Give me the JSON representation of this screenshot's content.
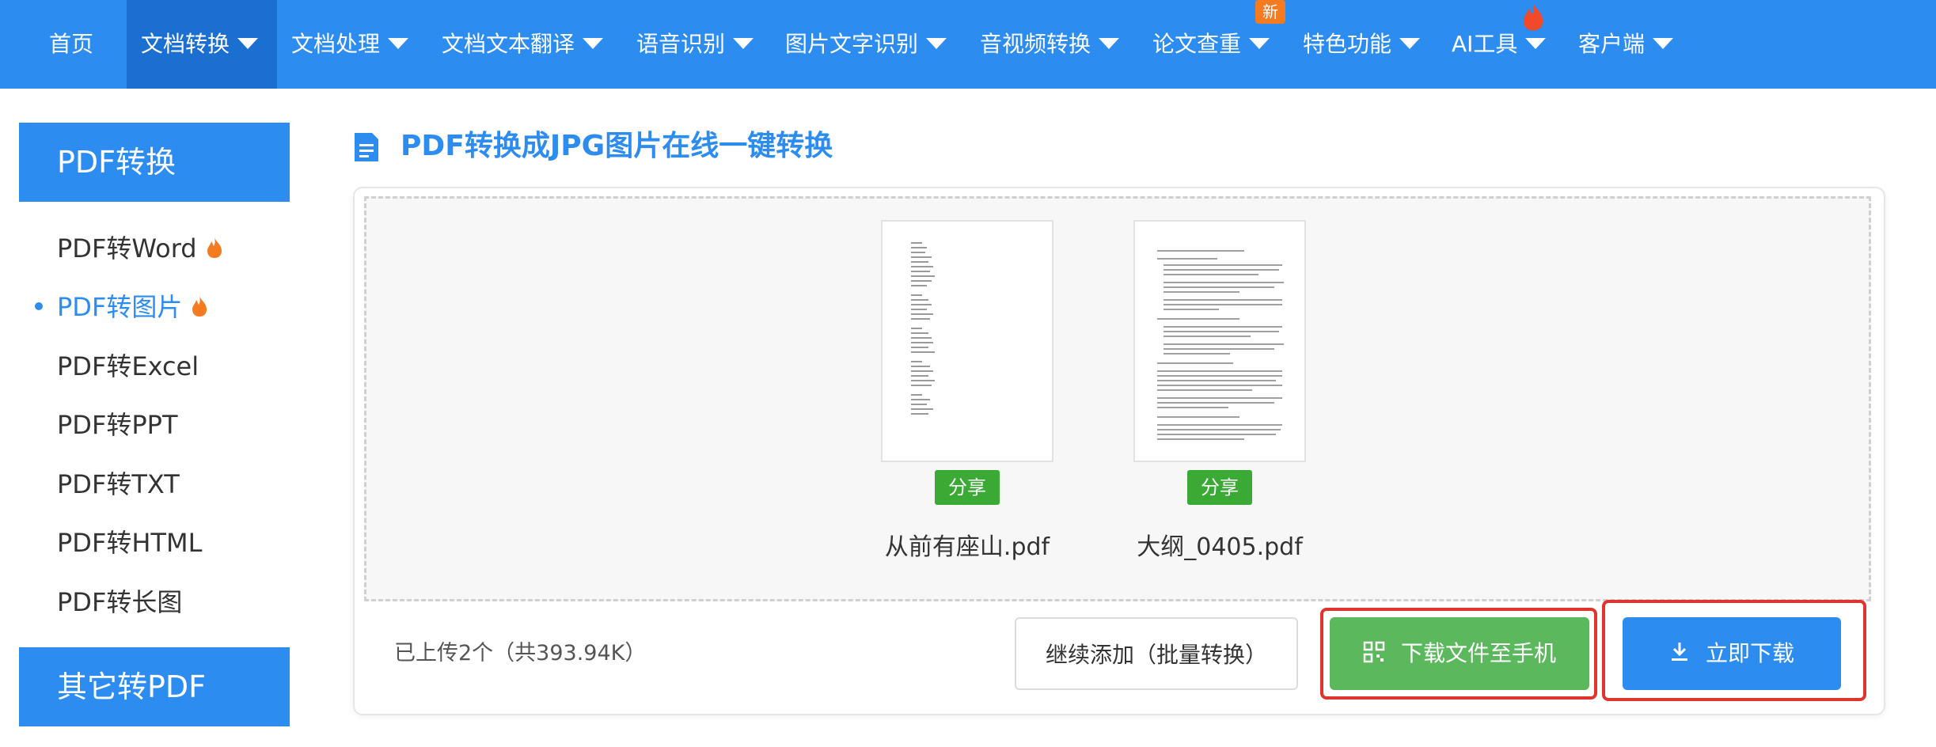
{
  "nav": {
    "items": [
      {
        "label": "首页"
      },
      {
        "label": "文档转换"
      },
      {
        "label": "文档处理"
      },
      {
        "label": "文档文本翻译"
      },
      {
        "label": "语音识别"
      },
      {
        "label": "图片文字识别"
      },
      {
        "label": "音视频转换"
      },
      {
        "label": "论文查重"
      },
      {
        "label": "特色功能"
      },
      {
        "label": "AI工具"
      },
      {
        "label": "客户端"
      }
    ],
    "new_badge": "新"
  },
  "sidebar": {
    "section1_title": "PDF转换",
    "items": [
      {
        "label": "PDF转Word",
        "hot": true
      },
      {
        "label": "PDF转图片",
        "hot": true,
        "active": true
      },
      {
        "label": "PDF转Excel"
      },
      {
        "label": "PDF转PPT"
      },
      {
        "label": "PDF转TXT"
      },
      {
        "label": "PDF转HTML"
      },
      {
        "label": "PDF转长图"
      }
    ],
    "section2_title": "其它转PDF"
  },
  "main": {
    "title": "PDF转换成JPG图片在线一键转换",
    "files": [
      {
        "name": "从前有座山.pdf",
        "share_label": "分享"
      },
      {
        "name": "大纲_0405.pdf",
        "share_label": "分享"
      }
    ],
    "upload_status": "已上传2个（共393.94K）",
    "add_more_label": "继续添加（批量转换）",
    "download_to_phone_label": "下载文件至手机",
    "download_now_label": "立即下载"
  },
  "colors": {
    "primary": "#2d8cf0",
    "nav_active": "#1a6fd0",
    "green": "#5cb85c",
    "share_green": "#3aaa35",
    "highlight_red": "#e0342e",
    "hot_orange": "#f47b20"
  }
}
